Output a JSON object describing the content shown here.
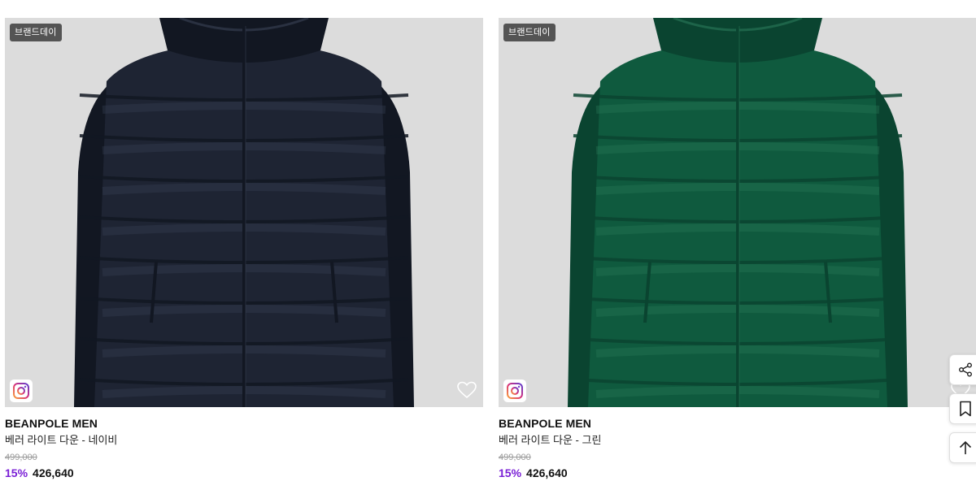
{
  "products": [
    {
      "badge": "브랜드데이",
      "brand": "BEANPOLE MEN",
      "name": "베러 라이트 다운 - 네이비",
      "original_price": "499,000",
      "discount": "15%",
      "sale_price": "426,640",
      "jacket_color": "#1e2433",
      "jacket_shade": "#121722",
      "jacket_highlight": "#3a4256"
    },
    {
      "badge": "브랜드데이",
      "brand": "BEANPOLE MEN",
      "name": "베러 라이트 다운 - 그린",
      "original_price": "499,000",
      "discount": "15%",
      "sale_price": "426,640",
      "jacket_color": "#0f5a3e",
      "jacket_shade": "#0a4430",
      "jacket_highlight": "#2a7a5a"
    }
  ],
  "icons": {
    "instagram": "instagram-icon",
    "wishlist": "heart-icon",
    "share": "share-icon",
    "bookmark": "bookmark-icon",
    "scroll_top": "arrow-up-icon"
  },
  "colors": {
    "discount": "#7a1fd6",
    "image_bg": "#dcdcdc"
  }
}
